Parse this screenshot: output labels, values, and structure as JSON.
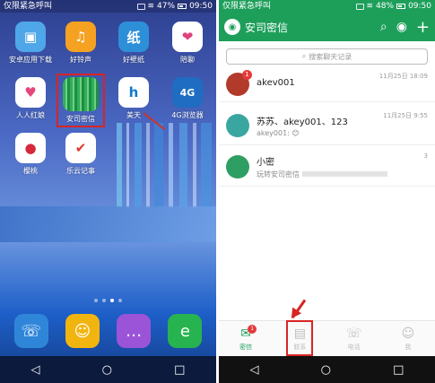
{
  "left_screen": {
    "status": {
      "carrier": "仅限紧急呼叫",
      "battery": "47%",
      "time": "09:50"
    },
    "apps": [
      {
        "label": "安卓应用下载",
        "icon": "bag-icon",
        "color": "#4fa6e8",
        "glyph": "▣"
      },
      {
        "label": "好铃声",
        "icon": "music-note-icon",
        "color": "#f5a121",
        "glyph": "♫"
      },
      {
        "label": "好壁纸",
        "icon": "wallpaper-icon",
        "color": "#2e8fd9",
        "glyph": "纸"
      },
      {
        "label": "陪聊",
        "icon": "heart-icon",
        "color": "#ffffff",
        "glyph": "❤"
      },
      {
        "label": "人人红娘",
        "icon": "heart-figure-icon",
        "color": "#ffffff",
        "glyph": "♥"
      },
      {
        "label": "安司密信",
        "icon": "app-glitch-icon",
        "color": "#2fae5a",
        "glyph": ""
      },
      {
        "label": "美天",
        "icon": "letter-h-icon",
        "color": "#0f79c9",
        "glyph": "h"
      },
      {
        "label": "4G浏览器",
        "icon": "globe-4g-icon",
        "color": "#1f6dc2",
        "glyph": "4G"
      },
      {
        "label": "樱桃",
        "icon": "cherry-icon",
        "color": "#ffffff",
        "glyph": "●"
      },
      {
        "label": "乐云记事",
        "icon": "check-circle-icon",
        "color": "#ffffff",
        "glyph": "✔"
      }
    ],
    "dock": [
      {
        "icon": "phone-icon",
        "color": "#2f86d9",
        "glyph": "☏"
      },
      {
        "icon": "contacts-icon",
        "color": "#f2b40f",
        "glyph": "☺"
      },
      {
        "icon": "messages-icon",
        "color": "#9b54d8",
        "glyph": "…"
      },
      {
        "icon": "browser-icon",
        "color": "#27b34f",
        "glyph": "e"
      }
    ],
    "nav": [
      "◁",
      "○",
      "□"
    ]
  },
  "right_screen": {
    "status": {
      "carrier": "仅限紧急呼叫",
      "battery": "48%",
      "time": "09:50"
    },
    "appbar": {
      "title": "安司密信",
      "actions": [
        "⌕",
        "◉",
        "+"
      ]
    },
    "search": {
      "placeholder": "搜索聊天记录"
    },
    "conversations": [
      {
        "name": "akev001",
        "preview": "",
        "time": "11月25日 18:09",
        "badge": "1",
        "avatar_color": "#b23a2a"
      },
      {
        "name": "苏苏、akey001、123",
        "preview": "akey001: 😊",
        "time": "11月25日 9:55",
        "badge": "",
        "avatar_color": "#3aa6a0"
      },
      {
        "name": "小密",
        "preview": "玩转安司密信",
        "time": "3",
        "badge": "",
        "avatar_color": "#2f9e63"
      }
    ],
    "tabs": [
      {
        "label": "密信",
        "icon": "chat-bubble-icon",
        "glyph": "✉",
        "badge": "1"
      },
      {
        "label": "联系",
        "icon": "contact-card-icon",
        "glyph": "▤",
        "badge": ""
      },
      {
        "label": "电话",
        "icon": "phone-handset-icon",
        "glyph": "☏",
        "badge": ""
      },
      {
        "label": "我",
        "icon": "person-icon",
        "glyph": "☺",
        "badge": ""
      }
    ],
    "nav": [
      "◁",
      "○",
      "□"
    ]
  }
}
